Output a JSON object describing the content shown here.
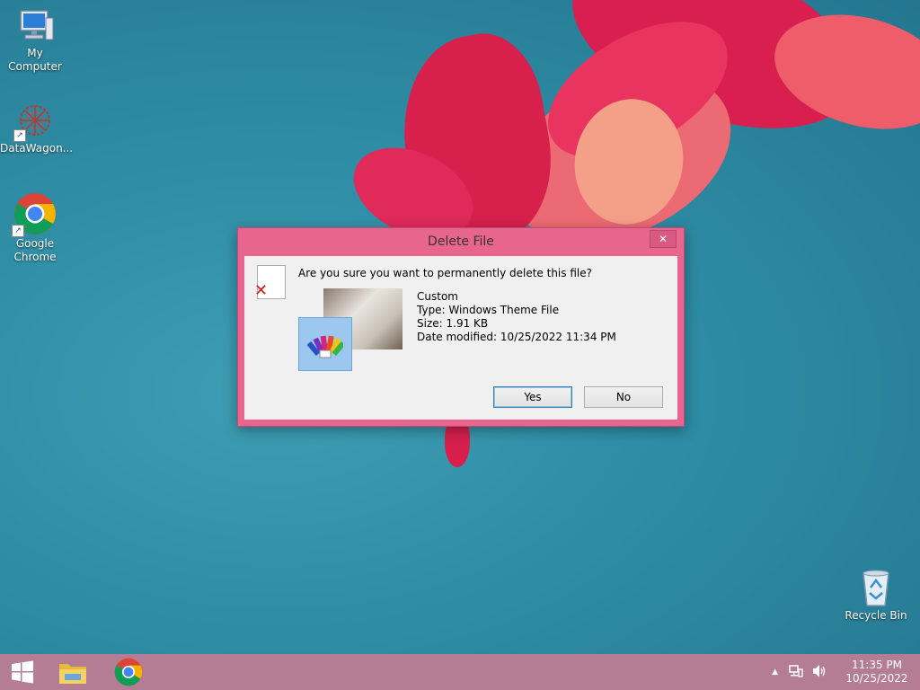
{
  "desktop": {
    "icons": [
      {
        "label": "My Computer",
        "icon": "computer-icon"
      },
      {
        "label": "DataWagon...",
        "icon": "datawagon-icon"
      },
      {
        "label": "Google Chrome",
        "icon": "chrome-icon"
      },
      {
        "label": "Recycle Bin",
        "icon": "recycle-bin-icon"
      }
    ]
  },
  "dialog": {
    "title": "Delete File",
    "close_symbol": "✕",
    "question": "Are you sure you want to permanently delete this file?",
    "file": {
      "name": "Custom",
      "type": "Type: Windows Theme File",
      "size": "Size: 1.91 KB",
      "modified": "Date modified: 10/25/2022 11:34 PM"
    },
    "yes_label": "Yes",
    "no_label": "No"
  },
  "taskbar": {
    "items": [
      "start-button",
      "file-explorer-icon",
      "chrome-icon"
    ],
    "tray_symbol": "▲",
    "time": "11:35 PM",
    "date": "10/25/2022"
  },
  "colors": {
    "dialog_frame": "#e8658f",
    "taskbar": "#b57d94",
    "desktop": "#2f8ea6"
  }
}
